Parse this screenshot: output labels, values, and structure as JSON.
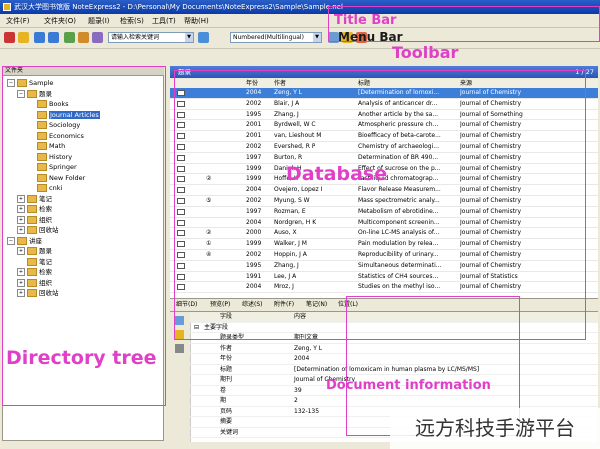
{
  "window": {
    "title": "武汉大学图书馆版 NoteExpress2 - D:\\Personal\\My Documents\\NoteExpress2\\Sample\\Sample.nel"
  },
  "menu": [
    "文件(F)",
    "文件夹(O)",
    "题录(I)",
    "检索(S)",
    "工具(T)",
    "帮助(H)"
  ],
  "toolbar": {
    "search_combo": "请输入检索关键词",
    "style_combo": "Numbered(Multilingual)"
  },
  "tree": {
    "header": "文件夹",
    "nodes": [
      {
        "label": "Sample",
        "level": 0,
        "expander": "−",
        "selected": false
      },
      {
        "label": "题录",
        "level": 1,
        "expander": "−",
        "selected": false
      },
      {
        "label": "Books",
        "level": 2,
        "expander": "",
        "selected": false
      },
      {
        "label": "Journal Articles",
        "level": 2,
        "expander": "",
        "selected": true
      },
      {
        "label": "Sociology",
        "level": 2,
        "expander": "",
        "selected": false
      },
      {
        "label": "Economics",
        "level": 2,
        "expander": "",
        "selected": false
      },
      {
        "label": "Math",
        "level": 2,
        "expander": "",
        "selected": false
      },
      {
        "label": "History",
        "level": 2,
        "expander": "",
        "selected": false
      },
      {
        "label": "Springer",
        "level": 2,
        "expander": "",
        "selected": false
      },
      {
        "label": "New Folder",
        "level": 2,
        "expander": "",
        "selected": false
      },
      {
        "label": "cnki",
        "level": 2,
        "expander": "",
        "selected": false
      },
      {
        "label": "笔记",
        "level": 1,
        "expander": "+",
        "selected": false
      },
      {
        "label": "检索",
        "level": 1,
        "expander": "+",
        "selected": false
      },
      {
        "label": "组织",
        "level": 1,
        "expander": "+",
        "selected": false
      },
      {
        "label": "回收站",
        "level": 1,
        "expander": "+",
        "selected": false
      },
      {
        "label": "讲座",
        "level": 0,
        "expander": "−",
        "selected": false
      },
      {
        "label": "题录",
        "level": 1,
        "expander": "+",
        "selected": false
      },
      {
        "label": "笔记",
        "level": 1,
        "expander": "",
        "selected": false
      },
      {
        "label": "检索",
        "level": 1,
        "expander": "+",
        "selected": false
      },
      {
        "label": "组织",
        "level": 1,
        "expander": "+",
        "selected": false
      },
      {
        "label": "回收站",
        "level": 1,
        "expander": "+",
        "selected": false
      }
    ]
  },
  "database": {
    "header": "题录",
    "page_info": "1 / 27",
    "columns": [
      "年份",
      "作者",
      "标题",
      "来源"
    ],
    "rows": [
      {
        "mark": "",
        "year": "2004",
        "author": "Zeng, Y L",
        "title": "[Determination of lornoxi...",
        "source": "Journal of Chemistry"
      },
      {
        "mark": "",
        "year": "2002",
        "author": "Blair, J A",
        "title": "Analysis of anticancer dr...",
        "source": "Journal of Chemistry"
      },
      {
        "mark": "",
        "year": "1995",
        "author": "Zhang, J",
        "title": "Another article by the sa...",
        "source": "Journal of Something"
      },
      {
        "mark": "",
        "year": "2001",
        "author": "Byrdwell, W C",
        "title": "Atmospheric pressure ch...",
        "source": "Journal of Chemistry"
      },
      {
        "mark": "",
        "year": "2001",
        "author": "van, Lieshout M",
        "title": "Bioefficacy of beta-carote...",
        "source": "Journal of Chemistry"
      },
      {
        "mark": "",
        "year": "2002",
        "author": "Evershed, R P",
        "title": "Chemistry of archaeologi...",
        "source": "Journal of Chemistry"
      },
      {
        "mark": "",
        "year": "1997",
        "author": "Burton, R",
        "title": "Determination of BR 490...",
        "source": "Journal of Chemistry"
      },
      {
        "mark": "",
        "year": "1999",
        "author": "Daniel, H",
        "title": "Effect of sucrose on the p...",
        "source": "Journal of Chemistry"
      },
      {
        "mark": "②",
        "year": "1999",
        "author": "Hoffe, K",
        "title": "Fast liquid chromatograp...",
        "source": "Journal of Chemistry"
      },
      {
        "mark": "",
        "year": "2004",
        "author": "Ovejero, Lopez I",
        "title": "Flavor Release Measurem...",
        "source": "Journal of Chemistry"
      },
      {
        "mark": "⑤",
        "year": "2002",
        "author": "Myung, S W",
        "title": "Mass spectrometric analy...",
        "source": "Journal of Chemistry"
      },
      {
        "mark": "",
        "year": "1997",
        "author": "Rozman, E",
        "title": "Metabolism of ebrotidine...",
        "source": "Journal of Chemistry"
      },
      {
        "mark": "",
        "year": "2004",
        "author": "Nordgren, H K",
        "title": "Multicomponent screenin...",
        "source": "Journal of Chemistry"
      },
      {
        "mark": "②",
        "year": "2000",
        "author": "Auso, X",
        "title": "On-line LC-MS analysis of...",
        "source": "Journal of Chemistry"
      },
      {
        "mark": "①",
        "year": "1999",
        "author": "Walker, J M",
        "title": "Pain modulation by relea...",
        "source": "Journal of Chemistry"
      },
      {
        "mark": "④",
        "year": "2002",
        "author": "Hoppin, J A",
        "title": "Reproducibility of urinary...",
        "source": "Journal of Chemistry"
      },
      {
        "mark": "",
        "year": "1995",
        "author": "Zhang, J",
        "title": "Simultaneous determinati...",
        "source": "Journal of Chemistry"
      },
      {
        "mark": "",
        "year": "1991",
        "author": "Lee, J A",
        "title": "Statistics of CH4 sources...",
        "source": "Journal of Statistics"
      },
      {
        "mark": "",
        "year": "2004",
        "author": "Mroz, J",
        "title": "Studies on the methyl iso...",
        "source": "Journal of Chemistry"
      }
    ]
  },
  "detail_tabs": [
    "细节(D)",
    "预览(P)",
    "综述(S)",
    "附件(F)",
    "笔记(N)",
    "位置(L)"
  ],
  "details": {
    "columns": [
      "字段",
      "内容"
    ],
    "group": "主要字段",
    "fields": [
      {
        "field": "题录类型",
        "value": "期刊文章"
      },
      {
        "field": "作者",
        "value": "Zeng, Y L"
      },
      {
        "field": "年份",
        "value": "2004"
      },
      {
        "field": "标题",
        "value": "[Determination of lornoxicam in human plasma by LC/MS/MS]"
      },
      {
        "field": "期刊",
        "value": "Journal of Chemistry"
      },
      {
        "field": "卷",
        "value": "39"
      },
      {
        "field": "期",
        "value": "2"
      },
      {
        "field": "页码",
        "value": "132-135"
      },
      {
        "field": "摘要",
        "value": ""
      },
      {
        "field": "关键词",
        "value": ""
      }
    ]
  },
  "annotations": {
    "title_bar": "Title Bar",
    "menu_bar": "Menu Bar",
    "toolbar": "Toolbar",
    "directory_tree": "Directory tree",
    "database": "Database",
    "document_information": "Document information"
  },
  "watermark": "远方科技手游平台",
  "colors": {
    "annotation": "#e040c8",
    "selection": "#3169c6",
    "header_blue": "#2a55b5"
  }
}
